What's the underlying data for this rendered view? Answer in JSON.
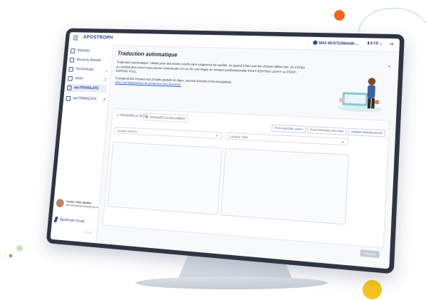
{
  "app": {
    "logo": "APOSTROPH"
  },
  "topbar": {
    "user": "MAX MUSTERMANN ⌄",
    "language": "FR ⌄",
    "logout_icon": "logout-icon"
  },
  "sidebar": {
    "items": [
      {
        "label": "Mandats",
        "icon": "folder-icon"
      },
      {
        "label": "Nouveau Mandat",
        "icon": "plus-folder-icon"
      },
      {
        "label": "Terminologie",
        "icon": "network-icon",
        "suffix": "⌄"
      },
      {
        "label": "aisuki",
        "icon": "chat-icon",
        "suffix": "ⓘ"
      },
      {
        "label": "apsTRANSLATE",
        "icon": "translate-icon"
      },
      {
        "label": "apsTRANSLATE",
        "icon": "translate-pro-icon",
        "suffix": "↗"
      }
    ],
    "contact": {
      "name": "Contact: NAEL BENNIS",
      "email": "nael.bennis@apostrophgroup.ch"
    },
    "group": "Apostroph Group",
    "version": "v 1.6.1"
  },
  "main": {
    "title": "Traduction automatique",
    "description": "Traduction automatique : idéale pour des textes courts sans exigences de qualité, ou quand il faut que les choses aillent vite. Et s'il faut un résultat plus exact vous pouvez commander en un clic une étape de révision professionnelle POST-EDITING LIGHT ou POST-EDITING FULL.",
    "note": "Contrairement à beaucoup d'outils gratuits en ligne, aucune donnée n'est enregistrée.",
    "link": "Voici nos dispositions de protection des données."
  },
  "card": {
    "tabs": [
      "TRADUIRE LE TEXTE",
      "TRADUIRE LE DOCUMENT"
    ],
    "modes": [
      "POST-EDITING LIGHT",
      "POST-EDITING FULL/500",
      "HUMAN TRANSLATION"
    ],
    "source_placeholder": "Langue source",
    "target_placeholder": "Langue cible",
    "translate_button": "Traduire"
  },
  "colors": {
    "brand": "#2a4a8c",
    "accent_orange": "#f7641b",
    "accent_yellow": "#f7c51e",
    "accent_green": "#8fd17a"
  }
}
